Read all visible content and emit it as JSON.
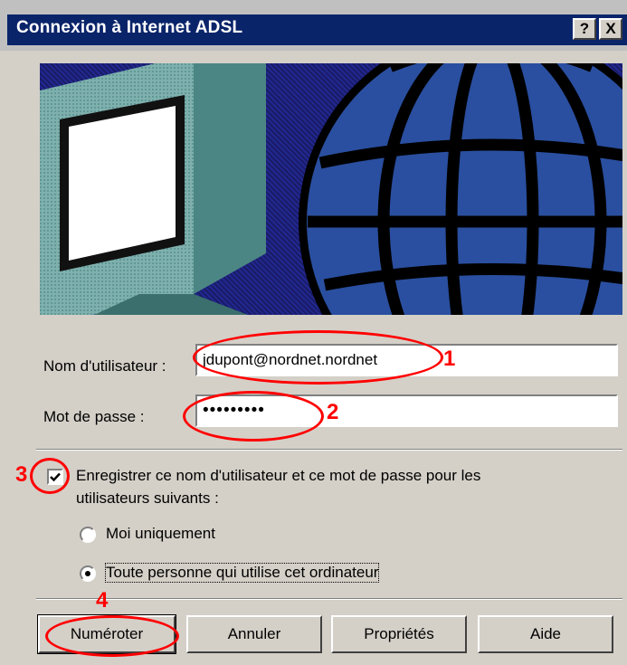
{
  "window": {
    "title": "Connexion à Internet ADSL",
    "help_glyph": "?",
    "close_glyph": "X"
  },
  "banner": {
    "icons": [
      "computer-monitor-icon",
      "globe-icon"
    ]
  },
  "form": {
    "username_label": "Nom d'utilisateur :",
    "username_value": "jdupont@nordnet.nordnet",
    "password_label": "Mot de passe :",
    "password_value": "•••••••••",
    "save_label_line1": "Enregistrer ce nom d'utilisateur et ce mot de passe pour les",
    "save_label_line2": "utilisateurs suivants :",
    "save_checked": true,
    "radio_me": "Moi uniquement",
    "radio_anyone": "Toute personne qui utilise cet ordinateur",
    "radio_selected": "anyone"
  },
  "buttons": {
    "dial": "Numéroter",
    "cancel": "Annuler",
    "properties": "Propriétés",
    "help": "Aide"
  },
  "annotations": [
    "1",
    "2",
    "3",
    "4"
  ],
  "colors": {
    "title_bar": "#0a246a",
    "dialog_bg": "#d4d0c8",
    "annotation": "#ff0000",
    "banner_bg": "#1b1b66",
    "globe": "#2a4fa0"
  }
}
